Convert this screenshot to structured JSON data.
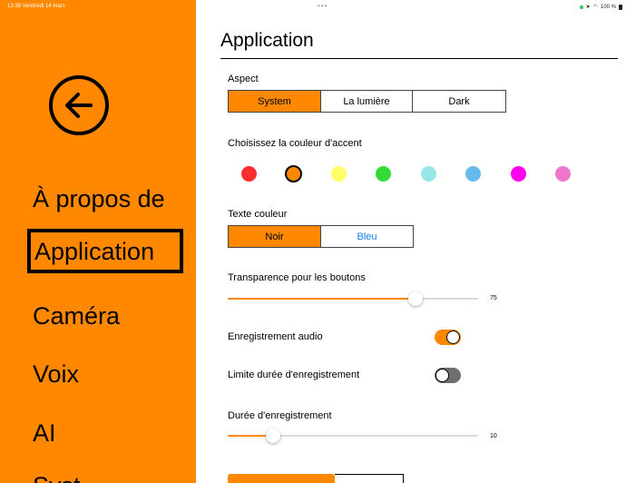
{
  "status_bar": {
    "time_date": "13:38  Vendredi 14 mars",
    "dots": "•••",
    "right": "100 %"
  },
  "sidebar": {
    "items": [
      {
        "label": "À propos de"
      },
      {
        "label": "Application",
        "selected": true
      },
      {
        "label": "Caméra"
      },
      {
        "label": "Voix"
      },
      {
        "label": "AI"
      },
      {
        "label": "Syst"
      }
    ]
  },
  "main": {
    "title": "Application",
    "aspect": {
      "label": "Aspect",
      "options": [
        "System",
        "La lumière",
        "Dark"
      ],
      "selected": "System"
    },
    "accent": {
      "label": "Choisissez la couleur d'accent",
      "colors": [
        "#ff2d2d",
        "#ff8800",
        "#ffff66",
        "#33dd33",
        "#99e6e6",
        "#66bbee",
        "#ff00ee",
        "#ee77cc"
      ],
      "selected_index": 1
    },
    "text_color": {
      "label": "Texte couleur",
      "options": [
        "Noir",
        "Bleu"
      ],
      "selected": "Noir"
    },
    "transparency": {
      "label": "Transparence pour les boutons",
      "value": "75",
      "fraction": 0.75
    },
    "audio_recording": {
      "label": "Enregistrement audio",
      "on": true
    },
    "duration_limit": {
      "label": "Limite durée d'enregistrement",
      "on": false
    },
    "recording_duration": {
      "label": "Durée d'enregistrement",
      "value": "10",
      "fraction": 0.18
    }
  },
  "colors": {
    "accent": "#ff8800",
    "link_blue": "#1a7be0"
  }
}
